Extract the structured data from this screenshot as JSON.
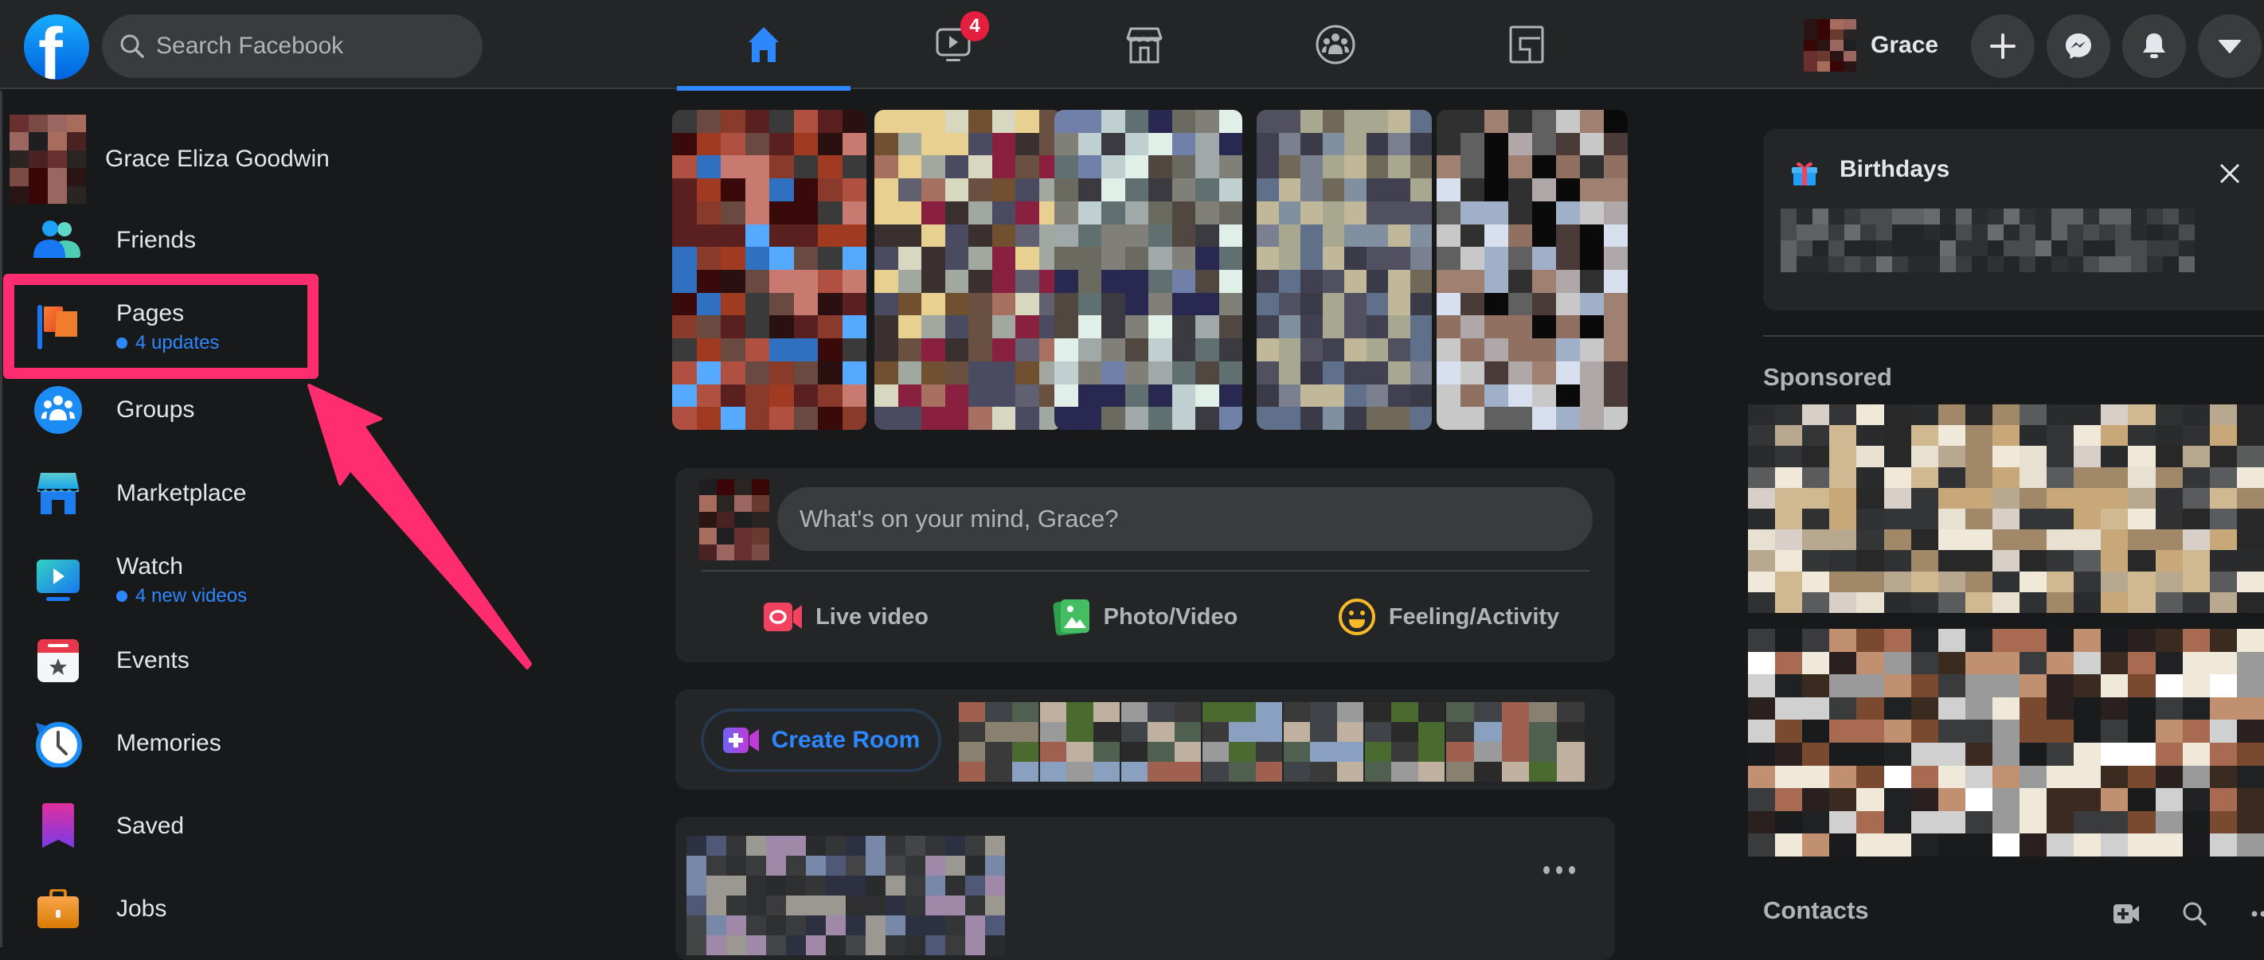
{
  "header": {
    "logo_letter": "f",
    "search_placeholder": "Search Facebook",
    "nav_tabs": [
      {
        "name": "home",
        "icon": "home-icon",
        "active": true,
        "badge": ""
      },
      {
        "name": "watch",
        "icon": "watch-icon",
        "active": false,
        "badge": "4"
      },
      {
        "name": "marketplace",
        "icon": "marketplace-icon",
        "active": false,
        "badge": ""
      },
      {
        "name": "groups",
        "icon": "groups-icon",
        "active": false,
        "badge": ""
      },
      {
        "name": "gaming",
        "icon": "gaming-icon",
        "active": false,
        "badge": ""
      }
    ],
    "profile_name": "Grace",
    "buttons": [
      {
        "name": "create",
        "icon": "plus-icon"
      },
      {
        "name": "messenger",
        "icon": "messenger-icon"
      },
      {
        "name": "notifications",
        "icon": "bell-icon"
      },
      {
        "name": "account",
        "icon": "caret-down-icon"
      }
    ]
  },
  "sidebar": {
    "items": [
      {
        "label": "Grace Eliza Goodwin",
        "sub": "",
        "icon": "profile-avatar"
      },
      {
        "label": "Friends",
        "sub": "",
        "icon": "friends-icon"
      },
      {
        "label": "Pages",
        "sub": "4 updates",
        "icon": "pages-flag-icon"
      },
      {
        "label": "Groups",
        "sub": "",
        "icon": "groups-icon"
      },
      {
        "label": "Marketplace",
        "sub": "",
        "icon": "marketplace-icon"
      },
      {
        "label": "Watch",
        "sub": "4 new videos",
        "icon": "watch-icon"
      },
      {
        "label": "Events",
        "sub": "",
        "icon": "events-calendar-icon"
      },
      {
        "label": "Memories",
        "sub": "",
        "icon": "memories-clock-icon"
      },
      {
        "label": "Saved",
        "sub": "",
        "icon": "saved-bookmark-icon"
      },
      {
        "label": "Jobs",
        "sub": "",
        "icon": "jobs-briefcase-icon"
      }
    ]
  },
  "annotation": {
    "highlight_target": "Pages",
    "color": "#ff2d6f"
  },
  "composer": {
    "placeholder": "What's on your mind, Grace?",
    "actions": [
      {
        "label": "Live video",
        "icon": "live-video-icon",
        "color": "#f3425f"
      },
      {
        "label": "Photo/Video",
        "icon": "photo-video-icon",
        "color": "#45bd62"
      },
      {
        "label": "Feeling/Activity",
        "icon": "feeling-smiley-icon",
        "color": "#f7b928"
      }
    ]
  },
  "rooms": {
    "create_label": "Create Room"
  },
  "right_rail": {
    "birthdays_title": "Birthdays",
    "sponsored_title": "Sponsored",
    "contacts_title": "Contacts"
  },
  "colors": {
    "accent": "#2d88ff",
    "background": "#18191a",
    "surface": "#242526",
    "surface_hover": "#3a3b3c",
    "text_primary": "#e4e6eb",
    "text_secondary": "#b0b3b8",
    "badge": "#e41e3f"
  }
}
